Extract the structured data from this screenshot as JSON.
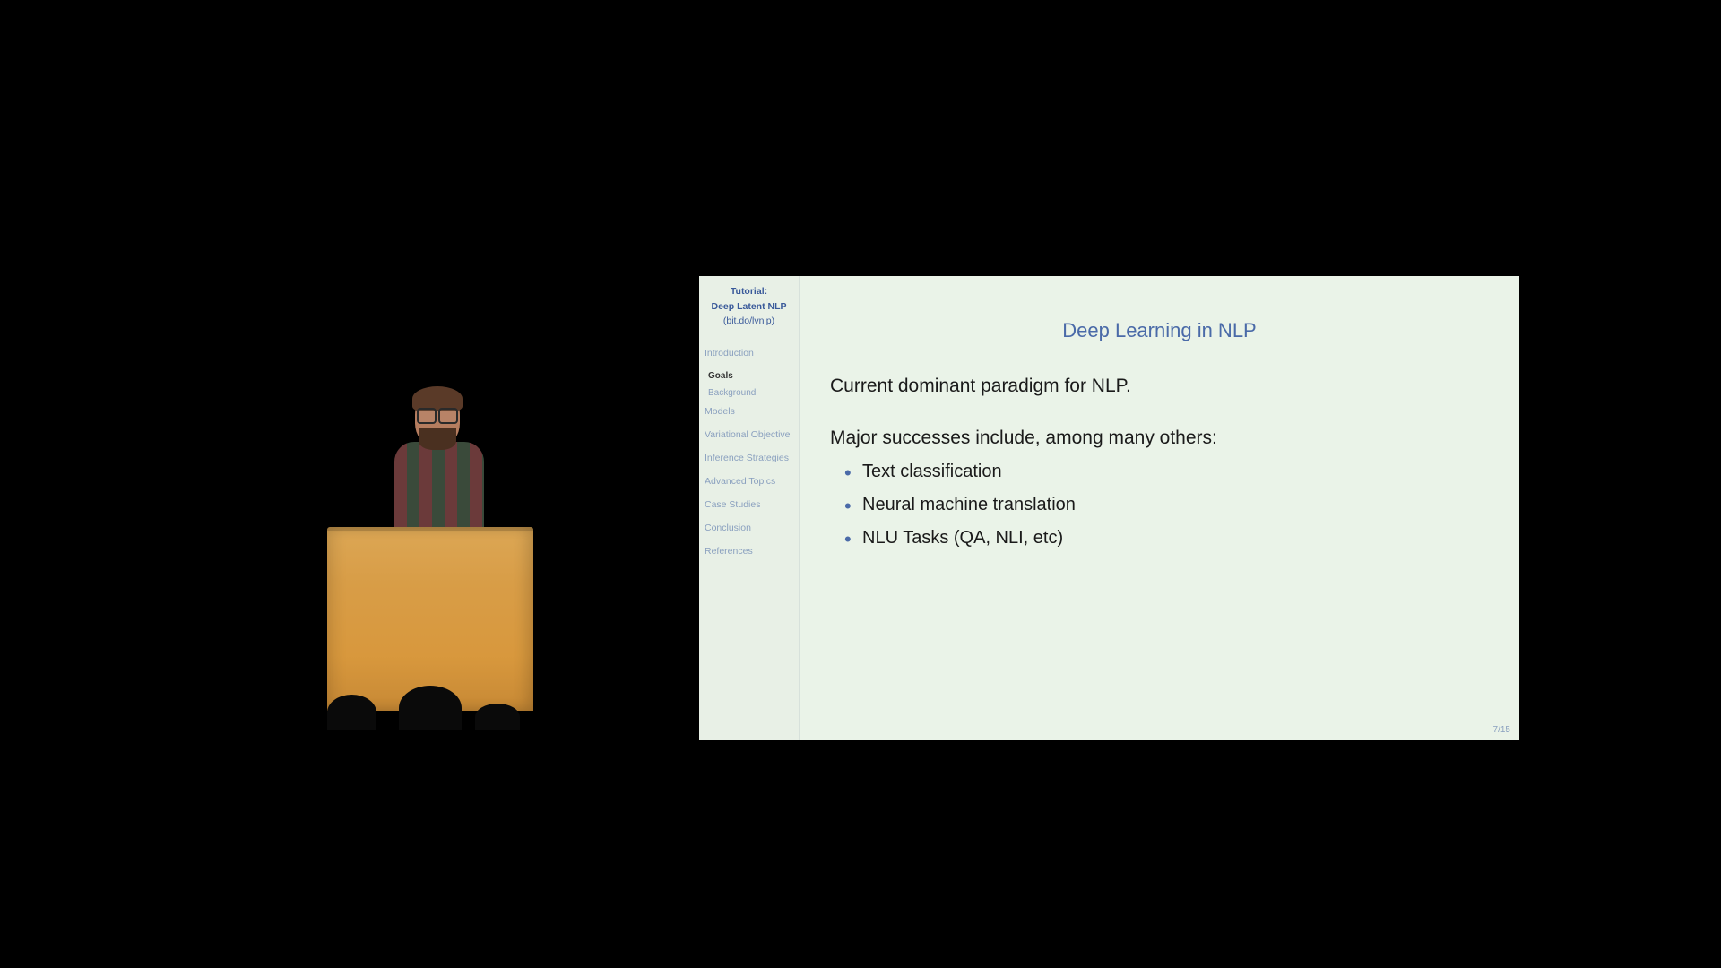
{
  "sidebar": {
    "title_line1": "Tutorial:",
    "title_line2": "Deep Latent NLP",
    "link": "(bit.do/lvnlp)",
    "items": [
      {
        "label": "Introduction",
        "active": false,
        "sub": false
      },
      {
        "label": "Goals",
        "active": true,
        "sub": true
      },
      {
        "label": "Background",
        "active": false,
        "sub": true
      },
      {
        "label": "Models",
        "active": false,
        "sub": false
      },
      {
        "label": "Variational Objective",
        "active": false,
        "sub": false
      },
      {
        "label": "Inference Strategies",
        "active": false,
        "sub": false
      },
      {
        "label": "Advanced Topics",
        "active": false,
        "sub": false
      },
      {
        "label": "Case Studies",
        "active": false,
        "sub": false
      },
      {
        "label": "Conclusion",
        "active": false,
        "sub": false
      },
      {
        "label": "References",
        "active": false,
        "sub": false
      }
    ]
  },
  "slide": {
    "title": "Deep Learning in NLP",
    "paragraph1": "Current dominant paradigm for NLP.",
    "paragraph2": "Major successes include, among many others:",
    "bullets": [
      "Text classification",
      "Neural machine translation",
      "NLU Tasks (QA, NLI, etc)"
    ],
    "page_number": "7/15"
  }
}
